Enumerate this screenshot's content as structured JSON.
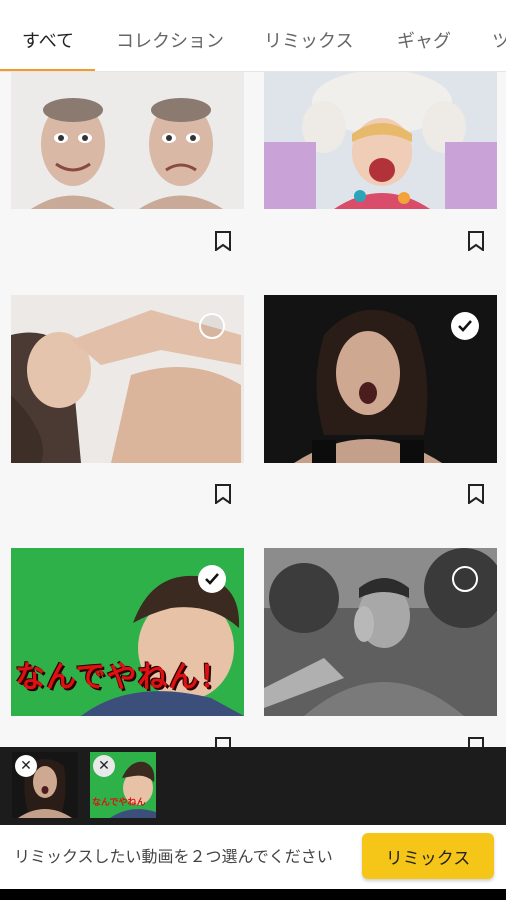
{
  "tabs": [
    {
      "label": "すべて",
      "active": true
    },
    {
      "label": "コレクション",
      "active": false
    },
    {
      "label": "リミックス",
      "active": false
    },
    {
      "label": "ギャグ",
      "active": false
    },
    {
      "label": "ツ",
      "active": false
    }
  ],
  "grid": {
    "items": [
      {
        "description": "two-faces",
        "selectable": false,
        "bookmarked": false
      },
      {
        "description": "girl-winter",
        "selectable": false,
        "bookmarked": false
      },
      {
        "description": "woman-pose",
        "selectable": true,
        "selected": false
      },
      {
        "description": "woman-yawn",
        "selectable": true,
        "selected": true
      },
      {
        "description": "man-greenscreen",
        "selectable": true,
        "selected": true,
        "caption": "なんでやねん！"
      },
      {
        "description": "man-hand-face",
        "selectable": true,
        "selected": false
      }
    ]
  },
  "tray": {
    "items": [
      {
        "description": "woman-yawn"
      },
      {
        "description": "man-greenscreen",
        "caption": "なんでやねん"
      }
    ]
  },
  "bottom": {
    "hint": "リミックスしたい動画を２つ選んでください",
    "button": "リミックス"
  },
  "colors": {
    "accent_underline": "#f39a2b",
    "button_yellow": "#f5c518",
    "tray_background": "#1c1c1c"
  },
  "icons": [
    "bookmark-icon",
    "checkmark-icon",
    "close-icon",
    "selection-circle-icon"
  ]
}
